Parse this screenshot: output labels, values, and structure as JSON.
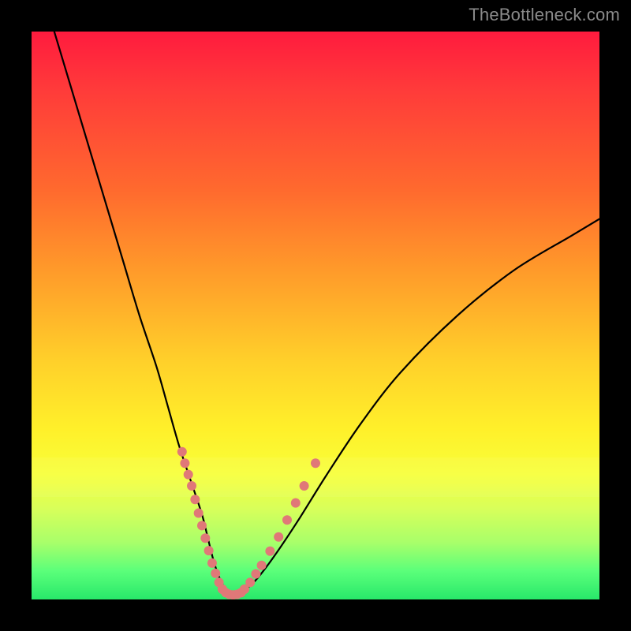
{
  "watermark": "TheBottleneck.com",
  "chart_data": {
    "type": "line",
    "title": "",
    "xlabel": "",
    "ylabel": "",
    "xlim": [
      0,
      100
    ],
    "ylim": [
      0,
      100
    ],
    "grid": false,
    "legend": false,
    "series": [
      {
        "name": "bottleneck-curve",
        "x": [
          4,
          7,
          10,
          13,
          16,
          19,
          22,
          24,
          26,
          28,
          30,
          31,
          32,
          33,
          34,
          35,
          36,
          38,
          40,
          43,
          47,
          52,
          58,
          65,
          75,
          85,
          95,
          100
        ],
        "y": [
          100,
          90,
          80,
          70,
          60,
          50,
          41,
          34,
          27,
          21,
          15,
          11,
          7,
          4,
          2,
          1,
          1,
          2,
          4,
          8,
          14,
          22,
          31,
          40,
          50,
          58,
          64,
          67
        ],
        "color": "#000000"
      },
      {
        "name": "dotted-overlay-left",
        "x": [
          26.5,
          27,
          27.6,
          28.2,
          28.8,
          29.4,
          30.0,
          30.6,
          31.2,
          31.8,
          32.4,
          33.0,
          33.6
        ],
        "y": [
          26.0,
          24.0,
          22.0,
          20.0,
          17.6,
          15.2,
          13.0,
          10.8,
          8.6,
          6.4,
          4.6,
          3.0,
          1.8
        ],
        "style": "dotted",
        "color": "#e07878"
      },
      {
        "name": "dotted-overlay-right",
        "x": [
          37.5,
          38.5,
          39.5,
          40.5,
          42.0,
          43.5,
          45.0,
          46.5,
          48.0,
          50.0
        ],
        "y": [
          1.8,
          3.0,
          4.5,
          6.0,
          8.5,
          11.0,
          14.0,
          17.0,
          20.0,
          24.0
        ],
        "style": "dotted",
        "color": "#e07878"
      },
      {
        "name": "dotted-overlay-bottom",
        "x": [
          33.6,
          34.2,
          34.8,
          35.5,
          36.2,
          36.9,
          37.5
        ],
        "y": [
          1.8,
          1.2,
          0.9,
          0.8,
          0.9,
          1.2,
          1.8
        ],
        "style": "dotted",
        "color": "#e07878"
      }
    ],
    "bands": [
      {
        "name": "pale-band",
        "y0": 18,
        "y1": 25,
        "alpha": 0.25
      }
    ]
  }
}
